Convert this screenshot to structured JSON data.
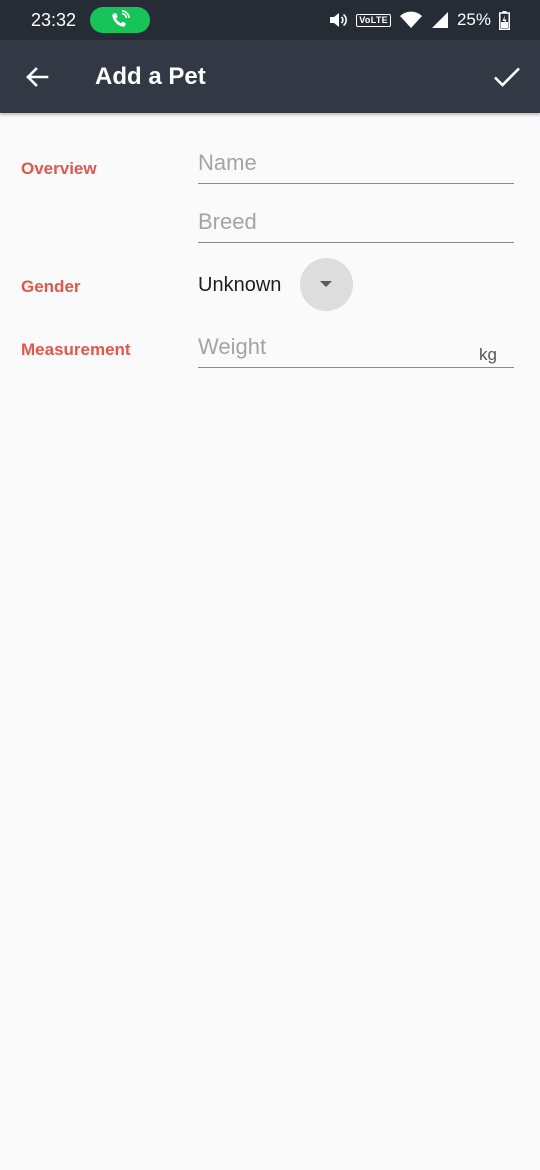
{
  "status_bar": {
    "time": "23:32",
    "network_badge": "VoLTE",
    "battery": "25%",
    "icons": [
      "call-active-icon",
      "volume-icon",
      "wifi-icon",
      "signal-icon",
      "battery-charging-icon"
    ]
  },
  "app_bar": {
    "title": "Add a Pet",
    "back_icon": "arrow-back-icon",
    "save_icon": "check-icon"
  },
  "form": {
    "overview": {
      "label": "Overview",
      "name_placeholder": "Name",
      "name_value": "",
      "breed_placeholder": "Breed",
      "breed_value": ""
    },
    "gender": {
      "label": "Gender",
      "value": "Unknown"
    },
    "measurement": {
      "label": "Measurement",
      "weight_placeholder": "Weight",
      "weight_value": "",
      "unit": "kg"
    }
  },
  "colors": {
    "status_bar_bg": "#262c36",
    "app_bar_bg": "#333944",
    "accent_label": "#e0574d",
    "call_pill": "#16c45a",
    "background": "#fafafa"
  }
}
